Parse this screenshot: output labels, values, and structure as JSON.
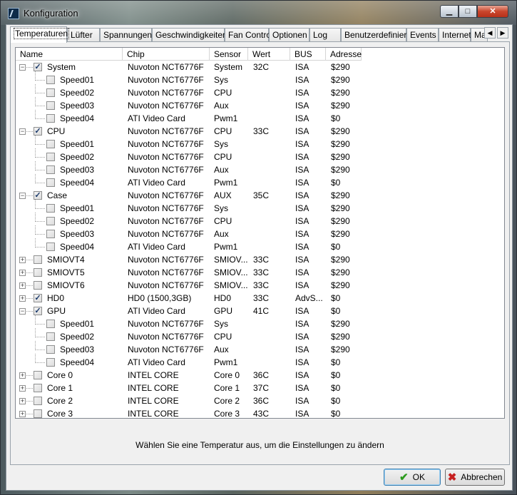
{
  "window": {
    "title": "Konfiguration"
  },
  "titlebar_buttons": {
    "minimize": "▁",
    "maximize": "□",
    "close": "✕"
  },
  "tabs": [
    {
      "label": "Temperaturen",
      "active": true
    },
    {
      "label": "Lüfter"
    },
    {
      "label": "Spannungen"
    },
    {
      "label": "Geschwindigkeiten"
    },
    {
      "label": "Fan Control"
    },
    {
      "label": "Optionen"
    },
    {
      "label": "Log"
    },
    {
      "label": "Benutzerdefiniert"
    },
    {
      "label": "Events"
    },
    {
      "label": "Internet"
    },
    {
      "label": "Mail"
    }
  ],
  "tab_scroll": {
    "left": "◀",
    "right": "▶"
  },
  "columns": [
    "Name",
    "Chip",
    "Sensor",
    "Wert",
    "BUS",
    "Adresse"
  ],
  "rows": [
    {
      "level": 0,
      "expander": "−",
      "checked": true,
      "name": "System",
      "chip": "Nuvoton NCT6776F",
      "sensor": "System",
      "wert": "32C",
      "bus": "ISA",
      "adresse": "$290"
    },
    {
      "level": 1,
      "checked": false,
      "name": "Speed01",
      "chip": "Nuvoton NCT6776F",
      "sensor": "Sys",
      "wert": "",
      "bus": "ISA",
      "adresse": "$290"
    },
    {
      "level": 1,
      "checked": false,
      "name": "Speed02",
      "chip": "Nuvoton NCT6776F",
      "sensor": "CPU",
      "wert": "",
      "bus": "ISA",
      "adresse": "$290"
    },
    {
      "level": 1,
      "checked": false,
      "name": "Speed03",
      "chip": "Nuvoton NCT6776F",
      "sensor": "Aux",
      "wert": "",
      "bus": "ISA",
      "adresse": "$290"
    },
    {
      "level": 1,
      "checked": false,
      "name": "Speed04",
      "chip": "ATI Video Card",
      "sensor": "Pwm1",
      "wert": "",
      "bus": "ISA",
      "adresse": "$0"
    },
    {
      "level": 0,
      "expander": "−",
      "checked": true,
      "name": "CPU",
      "chip": "Nuvoton NCT6776F",
      "sensor": "CPU",
      "wert": "33C",
      "bus": "ISA",
      "adresse": "$290"
    },
    {
      "level": 1,
      "checked": false,
      "name": "Speed01",
      "chip": "Nuvoton NCT6776F",
      "sensor": "Sys",
      "wert": "",
      "bus": "ISA",
      "adresse": "$290"
    },
    {
      "level": 1,
      "checked": false,
      "name": "Speed02",
      "chip": "Nuvoton NCT6776F",
      "sensor": "CPU",
      "wert": "",
      "bus": "ISA",
      "adresse": "$290"
    },
    {
      "level": 1,
      "checked": false,
      "name": "Speed03",
      "chip": "Nuvoton NCT6776F",
      "sensor": "Aux",
      "wert": "",
      "bus": "ISA",
      "adresse": "$290"
    },
    {
      "level": 1,
      "checked": false,
      "name": "Speed04",
      "chip": "ATI Video Card",
      "sensor": "Pwm1",
      "wert": "",
      "bus": "ISA",
      "adresse": "$0"
    },
    {
      "level": 0,
      "expander": "−",
      "checked": true,
      "name": "Case",
      "chip": "Nuvoton NCT6776F",
      "sensor": "AUX",
      "wert": "35C",
      "bus": "ISA",
      "adresse": "$290"
    },
    {
      "level": 1,
      "checked": false,
      "name": "Speed01",
      "chip": "Nuvoton NCT6776F",
      "sensor": "Sys",
      "wert": "",
      "bus": "ISA",
      "adresse": "$290"
    },
    {
      "level": 1,
      "checked": false,
      "name": "Speed02",
      "chip": "Nuvoton NCT6776F",
      "sensor": "CPU",
      "wert": "",
      "bus": "ISA",
      "adresse": "$290"
    },
    {
      "level": 1,
      "checked": false,
      "name": "Speed03",
      "chip": "Nuvoton NCT6776F",
      "sensor": "Aux",
      "wert": "",
      "bus": "ISA",
      "adresse": "$290"
    },
    {
      "level": 1,
      "checked": false,
      "name": "Speed04",
      "chip": "ATI Video Card",
      "sensor": "Pwm1",
      "wert": "",
      "bus": "ISA",
      "adresse": "$0"
    },
    {
      "level": 0,
      "expander": "+",
      "checked": false,
      "name": "SMIOVT4",
      "chip": "Nuvoton NCT6776F",
      "sensor": "SMIOV...",
      "wert": "33C",
      "bus": "ISA",
      "adresse": "$290"
    },
    {
      "level": 0,
      "expander": "+",
      "checked": false,
      "name": "SMIOVT5",
      "chip": "Nuvoton NCT6776F",
      "sensor": "SMIOV...",
      "wert": "33C",
      "bus": "ISA",
      "adresse": "$290"
    },
    {
      "level": 0,
      "expander": "+",
      "checked": false,
      "name": "SMIOVT6",
      "chip": "Nuvoton NCT6776F",
      "sensor": "SMIOV...",
      "wert": "33C",
      "bus": "ISA",
      "adresse": "$290"
    },
    {
      "level": 0,
      "expander": "+",
      "checked": true,
      "name": "HD0",
      "chip": "HD0 (1500,3GB)",
      "sensor": "HD0",
      "wert": "33C",
      "bus": "AdvS...",
      "adresse": "$0"
    },
    {
      "level": 0,
      "expander": "−",
      "checked": true,
      "name": "GPU",
      "chip": "ATI Video Card",
      "sensor": "GPU",
      "wert": "41C",
      "bus": "ISA",
      "adresse": "$0"
    },
    {
      "level": 1,
      "checked": false,
      "name": "Speed01",
      "chip": "Nuvoton NCT6776F",
      "sensor": "Sys",
      "wert": "",
      "bus": "ISA",
      "adresse": "$290"
    },
    {
      "level": 1,
      "checked": false,
      "name": "Speed02",
      "chip": "Nuvoton NCT6776F",
      "sensor": "CPU",
      "wert": "",
      "bus": "ISA",
      "adresse": "$290"
    },
    {
      "level": 1,
      "checked": false,
      "name": "Speed03",
      "chip": "Nuvoton NCT6776F",
      "sensor": "Aux",
      "wert": "",
      "bus": "ISA",
      "adresse": "$290"
    },
    {
      "level": 1,
      "checked": false,
      "name": "Speed04",
      "chip": "ATI Video Card",
      "sensor": "Pwm1",
      "wert": "",
      "bus": "ISA",
      "adresse": "$0"
    },
    {
      "level": 0,
      "expander": "+",
      "checked": false,
      "name": "Core 0",
      "chip": "INTEL CORE",
      "sensor": "Core 0",
      "wert": "36C",
      "bus": "ISA",
      "adresse": "$0"
    },
    {
      "level": 0,
      "expander": "+",
      "checked": false,
      "name": "Core 1",
      "chip": "INTEL CORE",
      "sensor": "Core 1",
      "wert": "37C",
      "bus": "ISA",
      "adresse": "$0"
    },
    {
      "level": 0,
      "expander": "+",
      "checked": false,
      "name": "Core 2",
      "chip": "INTEL CORE",
      "sensor": "Core 2",
      "wert": "36C",
      "bus": "ISA",
      "adresse": "$0"
    },
    {
      "level": 0,
      "expander": "+",
      "checked": false,
      "name": "Core 3",
      "chip": "INTEL CORE",
      "sensor": "Core 3",
      "wert": "43C",
      "bus": "ISA",
      "adresse": "$0"
    }
  ],
  "checkmark": "✓",
  "hint": "Wählen Sie eine Temperatur aus, um die Einstellungen zu ändern",
  "buttons": {
    "ok": "OK",
    "ok_icon": "✔",
    "cancel": "Abbrechen",
    "cancel_icon": "✖"
  }
}
